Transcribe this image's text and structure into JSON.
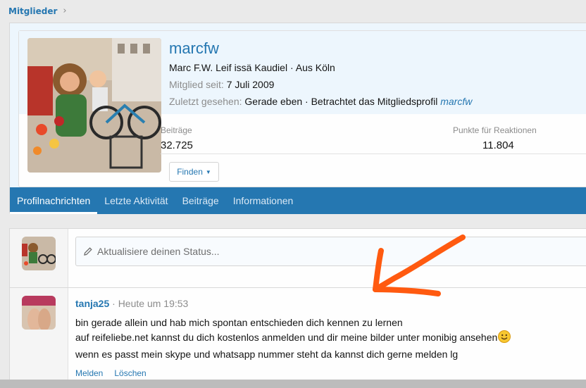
{
  "breadcrumb": {
    "item": "Mitglieder",
    "chevron": "›"
  },
  "profile": {
    "username": "marcfw",
    "details": "Marc F.W. Leif issä Kaudiel · Aus Köln",
    "member_since_label": "Mitglied seit:",
    "member_since_value": "7 Juli 2009",
    "last_seen_label": "Zuletzt gesehen:",
    "last_seen_value": "Gerade eben · Betrachtet das Mitgliedsprofil",
    "last_seen_link": "marcfw",
    "stats": [
      {
        "label": "Beiträge",
        "value": "32.725"
      },
      {
        "label": "Punkte für Reaktionen",
        "value": "11.804"
      }
    ],
    "find_button": "Finden"
  },
  "tabs": [
    {
      "label": "Profilnachrichten",
      "active": true
    },
    {
      "label": "Letzte Aktivität",
      "active": false
    },
    {
      "label": "Beiträge",
      "active": false
    },
    {
      "label": "Informationen",
      "active": false
    }
  ],
  "status": {
    "placeholder": "Aktualisiere deinen Status..."
  },
  "post": {
    "author": "tanja25",
    "time": "· Heute um 19:53",
    "lines": [
      "bin gerade allein und hab mich spontan entschieden dich kennen zu lernen",
      "auf reifeliebe.net kannst du dich kostenlos anmelden und dir meine bilder unter monibig ansehen",
      "wenn es passt mein skype und whatsapp nummer steht da kannst dich gerne melden lg"
    ],
    "actions": [
      "Melden",
      "Löschen"
    ]
  },
  "colors": {
    "accent": "#2577b1",
    "annotation_arrow": "#ff5a10"
  }
}
